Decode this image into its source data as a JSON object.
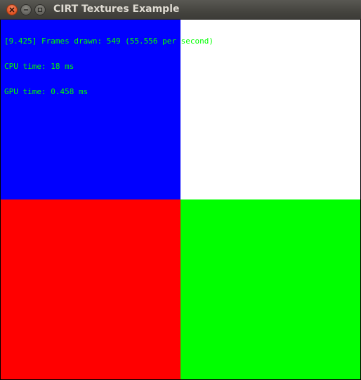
{
  "window": {
    "title": "CIRT Textures Example",
    "buttons": [
      {
        "name": "close",
        "icon": "close-icon"
      },
      {
        "name": "minimize",
        "icon": "minimize-icon"
      },
      {
        "name": "maximize",
        "icon": "maximize-icon"
      }
    ]
  },
  "canvas": {
    "quadrants": [
      {
        "position": "top-left",
        "color": "#0000ff"
      },
      {
        "position": "top-right",
        "color": "#ffffff"
      },
      {
        "position": "bottom-left",
        "color": "#ff0000"
      },
      {
        "position": "bottom-right",
        "color": "#00ff00"
      }
    ]
  },
  "overlay": {
    "color": "#00ff00",
    "frames_line": "[9.425] Frames drawn: 549 (55.556 per second)",
    "cpu_line": "CPU time: 18 ms",
    "gpu_line": "GPU time: 0.458 ms"
  }
}
